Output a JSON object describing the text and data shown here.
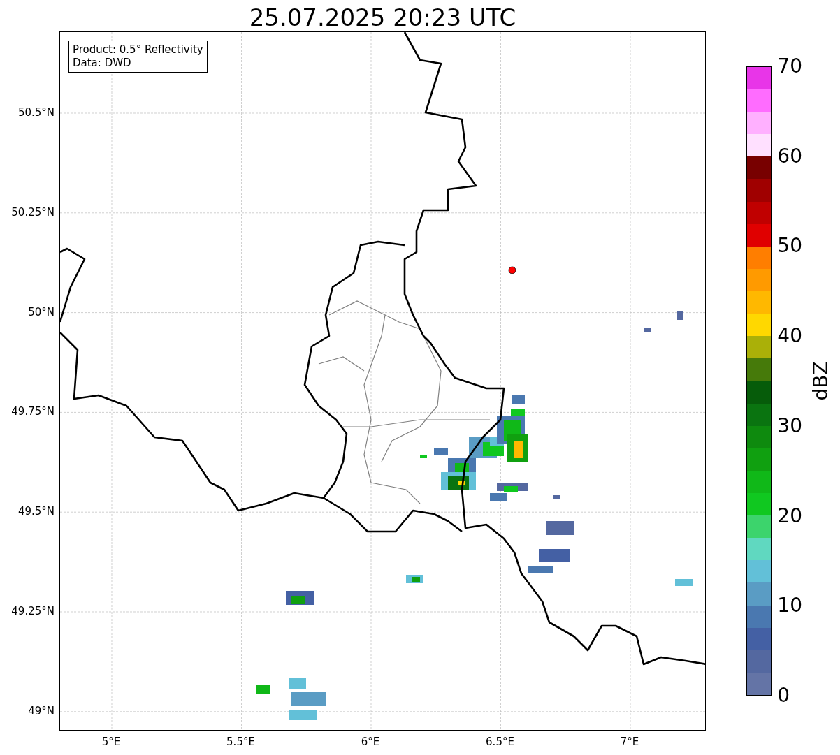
{
  "title": "25.07.2025 20:23 UTC",
  "info_box": [
    "Product: 0.5° Reflectivity",
    "Data: DWD"
  ],
  "map": {
    "lat_ticks": [
      "50.5°N",
      "50.25°N",
      "50°N",
      "49.75°N",
      "49.5°N",
      "49.25°N",
      "49°N"
    ],
    "lon_ticks": [
      "5°E",
      "5.5°E",
      "6°E",
      "6.5°E",
      "7°E"
    ]
  },
  "colorbar": {
    "label": "dBZ",
    "ticks": [
      "70",
      "60",
      "50",
      "40",
      "30",
      "20",
      "10",
      "0"
    ],
    "segments": [
      {
        "color": "#6474a6"
      },
      {
        "color": "#5468a0"
      },
      {
        "color": "#4460a4"
      },
      {
        "color": "#4a78b0"
      },
      {
        "color": "#5a9cc4"
      },
      {
        "color": "#62c0d8"
      },
      {
        "color": "#60d8c0"
      },
      {
        "color": "#3cd46c"
      },
      {
        "color": "#10c820"
      },
      {
        "color": "#10b818"
      },
      {
        "color": "#10a010"
      },
      {
        "color": "#0e8a0e"
      },
      {
        "color": "#0a7410"
      },
      {
        "color": "#065c0a"
      },
      {
        "color": "#467a0a"
      },
      {
        "color": "#aab008"
      },
      {
        "color": "#ffd800"
      },
      {
        "color": "#ffb800"
      },
      {
        "color": "#ff9a00"
      },
      {
        "color": "#ff7e00"
      },
      {
        "color": "#e00000"
      },
      {
        "color": "#c00000"
      },
      {
        "color": "#a00000"
      },
      {
        "color": "#780000"
      },
      {
        "color": "#ffe0ff"
      },
      {
        "color": "#ffb0ff"
      },
      {
        "color": "#ff6cff"
      },
      {
        "color": "#e835e8"
      }
    ]
  }
}
